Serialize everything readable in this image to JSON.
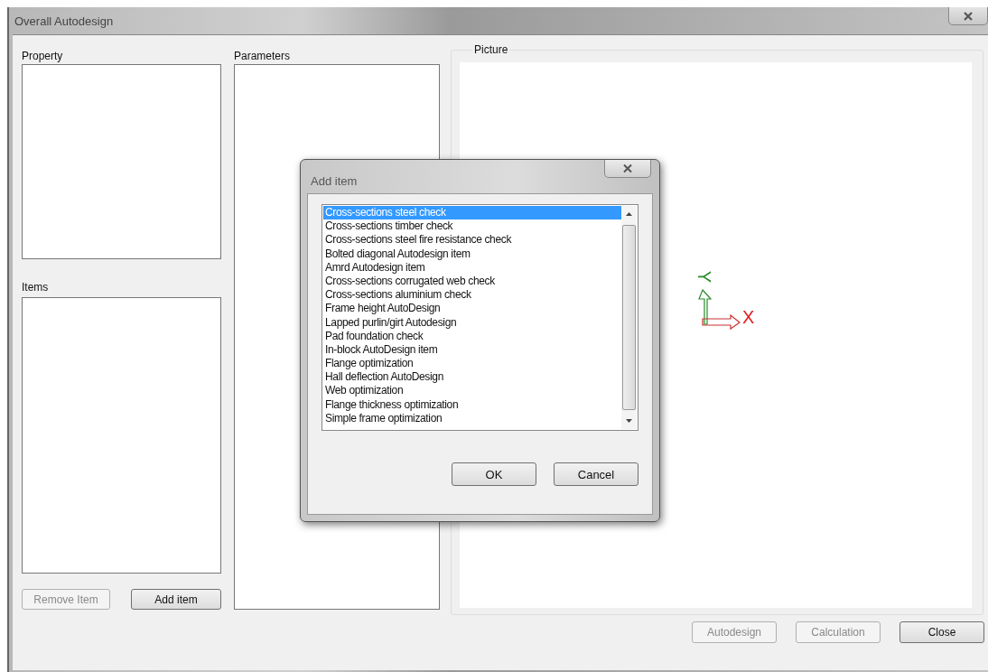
{
  "window": {
    "title": "Overall Autodesign"
  },
  "property": {
    "label": "Property"
  },
  "items": {
    "label": "Items",
    "buttons": [
      {
        "label": "Remove Item",
        "disabled": true
      },
      {
        "label": "Add item",
        "disabled": false
      }
    ]
  },
  "parameters": {
    "label": "Parameters"
  },
  "picture": {
    "label": "Picture",
    "x_label": "X",
    "y_label": "Y"
  },
  "footer_buttons": [
    {
      "label": "Autodesign",
      "disabled": true
    },
    {
      "label": "Calculation",
      "disabled": true
    },
    {
      "label": "Close",
      "disabled": false
    }
  ],
  "dialog": {
    "title": "Add item",
    "options": [
      {
        "label": "Cross-sections steel check",
        "selected": true
      },
      {
        "label": "Cross-sections timber check",
        "selected": false
      },
      {
        "label": "Cross-sections steel fire resistance check",
        "selected": false
      },
      {
        "label": "Bolted diagonal Autodesign item",
        "selected": false
      },
      {
        "label": "Amrd Autodesign item",
        "selected": false
      },
      {
        "label": "Cross-sections corrugated web check",
        "selected": false
      },
      {
        "label": "Cross-sections aluminium check",
        "selected": false
      },
      {
        "label": "Frame height AutoDesign",
        "selected": false
      },
      {
        "label": "Lapped purlin/girt Autodesign",
        "selected": false
      },
      {
        "label": "Pad foundation check",
        "selected": false
      },
      {
        "label": "In-block AutoDesign item",
        "selected": false
      },
      {
        "label": "Flange optimization",
        "selected": false
      },
      {
        "label": "Hall deflection AutoDesign",
        "selected": false
      },
      {
        "label": "Web optimization",
        "selected": false
      },
      {
        "label": "Flange thickness optimization",
        "selected": false
      },
      {
        "label": "Simple frame optimization",
        "selected": false
      }
    ],
    "buttons": [
      "OK",
      "Cancel"
    ]
  }
}
